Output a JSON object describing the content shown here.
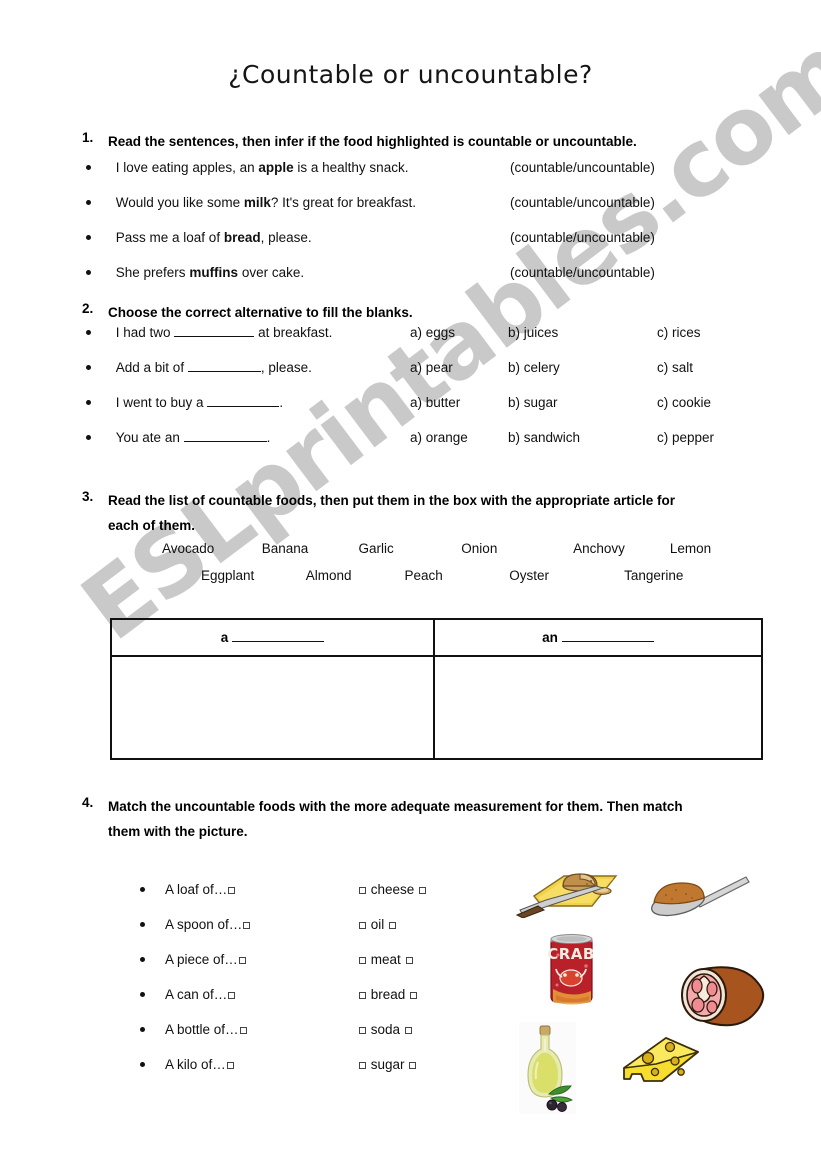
{
  "document": {
    "title": "¿Countable or uncountable?",
    "watermark": "ESLprintables.com",
    "watermark_color": "#c9c9c9"
  },
  "exercise1": {
    "number": "1.",
    "instruction": "Read the sentences, then infer if the food highlighted is countable or uncountable.",
    "tag": "(countable/uncountable)",
    "items": [
      {
        "pre": "I love eating apples, an ",
        "bold": "apple",
        "post": " is a healthy snack.",
        "tag": "(countable/uncountable)"
      },
      {
        "pre": "Would you like some ",
        "bold": "milk",
        "post": "? It's great for breakfast.",
        "tag": "(countable/uncountable)"
      },
      {
        "pre": "Pass me a loaf of ",
        "bold": "bread",
        "post": ", please.",
        "tag": "(countable/uncountable)"
      },
      {
        "pre": "She prefers ",
        "bold": "muffins",
        "post": " over cake.",
        "tag": "(countable/uncountable)"
      }
    ]
  },
  "exercise2": {
    "number": "2.",
    "instruction": "Choose the correct alternative to fill the blanks.",
    "items": [
      {
        "pre": "I had two ",
        "post": " at breakfast.",
        "a": "a) eggs",
        "b": "b) juices",
        "c": "c) rices"
      },
      {
        "pre": "Add a bit of ",
        "post": ", please.",
        "a": "a) pear",
        "b": "b) celery",
        "c": "c) salt"
      },
      {
        "pre": "I went to buy a ",
        "post": ".",
        "a": "a) butter",
        "b": "b) sugar",
        "c": "c) cookie"
      },
      {
        "pre": "You ate an ",
        "post": ".",
        "a": "a) orange",
        "b": "b) sandwich",
        "c": "c) pepper"
      }
    ]
  },
  "exercise3": {
    "number": "3.",
    "instruction_line1": "Read the list of countable foods, then put them in the box with the appropriate article for",
    "instruction_line2": "each of them.",
    "words_row1": [
      "Avocado",
      "Banana",
      "Garlic",
      "Onion",
      "Anchovy",
      "Lemon"
    ],
    "words_row2": [
      "Eggplant",
      "Almond",
      "Peach",
      "Oyster",
      "Tangerine"
    ],
    "table": {
      "header_a": "a",
      "header_an": "an",
      "answers_a": "",
      "answers_an": ""
    }
  },
  "exercise4": {
    "number": "4.",
    "instruction_line1": "Match the uncountable foods with the more adequate measurement for them. Then match",
    "instruction_line2": "them with the picture.",
    "measurements": [
      "A loaf of…",
      "A spoon of…",
      "A piece of…",
      "A can of…",
      "A bottle of…",
      "A kilo of…"
    ],
    "foods": [
      "cheese",
      "oil",
      "meat",
      "bread",
      "soda",
      "sugar"
    ],
    "pictures": [
      {
        "name": "bread-on-cutting-board-image",
        "alt": "loaf of bread on a yellow cutting board with knife"
      },
      {
        "name": "spoon-of-sugar-image",
        "alt": "spoon holding brown sugar"
      },
      {
        "name": "soda-can-image",
        "alt": "red soda can labelled CRAB",
        "label": "CRAB"
      },
      {
        "name": "ham-meat-image",
        "alt": "piece of ham meat"
      },
      {
        "name": "olive-oil-bottle-image",
        "alt": "bottle of olive oil with olives"
      },
      {
        "name": "cheese-wedge-image",
        "alt": "yellow swiss cheese wedge"
      }
    ]
  }
}
